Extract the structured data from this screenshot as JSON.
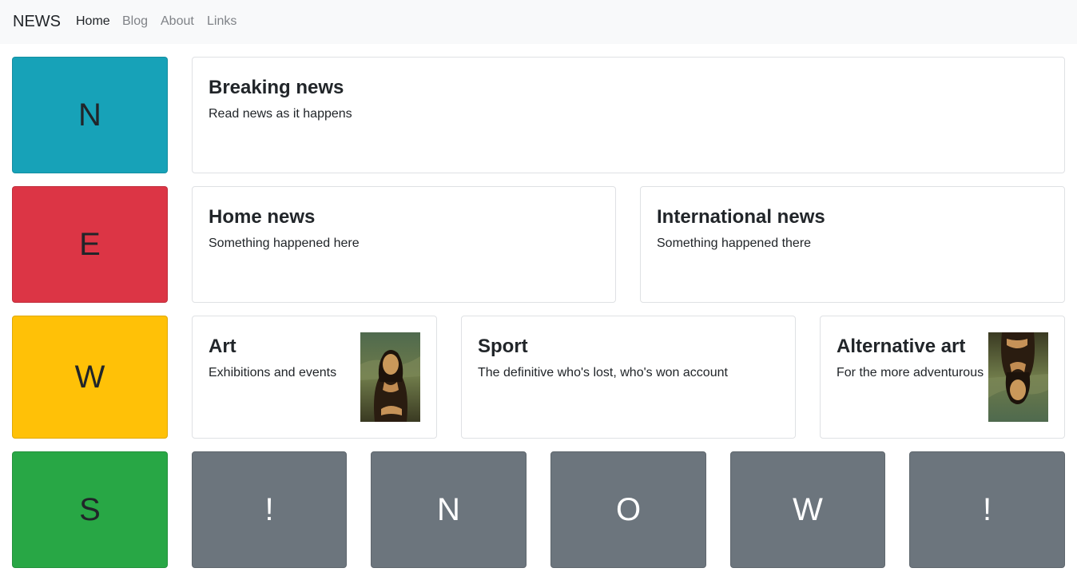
{
  "navbar": {
    "brand": "NEWS",
    "links": [
      {
        "label": "Home",
        "active": true
      },
      {
        "label": "Blog",
        "active": false
      },
      {
        "label": "About",
        "active": false
      },
      {
        "label": "Links",
        "active": false
      }
    ]
  },
  "side_tiles": [
    {
      "letter": "N",
      "color": "#17a2b8"
    },
    {
      "letter": "E",
      "color": "#dc3545"
    },
    {
      "letter": "W",
      "color": "#ffc107"
    },
    {
      "letter": "S",
      "color": "#28a745"
    }
  ],
  "cards": {
    "breaking": {
      "title": "Breaking news",
      "text": "Read news as it happens"
    },
    "home": {
      "title": "Home news",
      "text": "Something happened here"
    },
    "international": {
      "title": "International news",
      "text": "Something happened there"
    },
    "art": {
      "title": "Art",
      "text": "Exhibitions and events",
      "image": "mona-lisa-painting"
    },
    "sport": {
      "title": "Sport",
      "text": "The definitive who's lost, who's won account"
    },
    "alternative_art": {
      "title": "Alternative art",
      "text": "For the more adventurous",
      "image": "mona-lisa-painting-upside-down"
    }
  },
  "bottom_tiles": {
    "color": "#6c757d",
    "letters": [
      "!",
      "N",
      "O",
      "W",
      "!"
    ]
  }
}
